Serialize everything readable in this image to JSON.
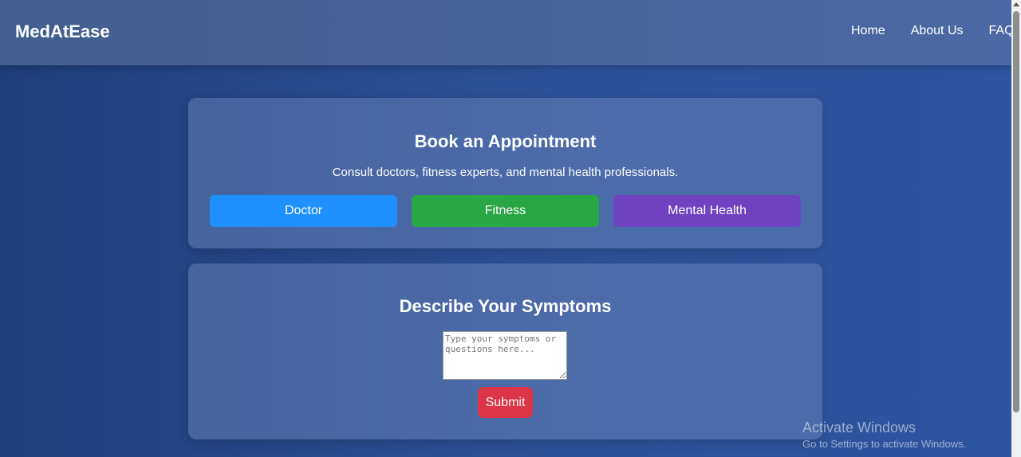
{
  "navbar": {
    "brand": "MedAtEase",
    "links": [
      "Home",
      "About Us",
      "FAQs"
    ]
  },
  "booking": {
    "title": "Book an Appointment",
    "subtitle": "Consult doctors, fitness experts, and mental health professionals.",
    "buttons": {
      "doctor": "Doctor",
      "fitness": "Fitness",
      "mental_health": "Mental Health"
    }
  },
  "symptoms": {
    "title": "Describe Your Symptoms",
    "placeholder": "Type your symptoms or questions here...",
    "value": "",
    "submit_label": "Submit"
  },
  "watermark": {
    "title": "Activate Windows",
    "subtitle": "Go to Settings to activate Windows."
  },
  "colors": {
    "doctor": "#1f90fe",
    "fitness": "#29a745",
    "mental_health": "#6f42c1",
    "submit": "#dc3545"
  }
}
